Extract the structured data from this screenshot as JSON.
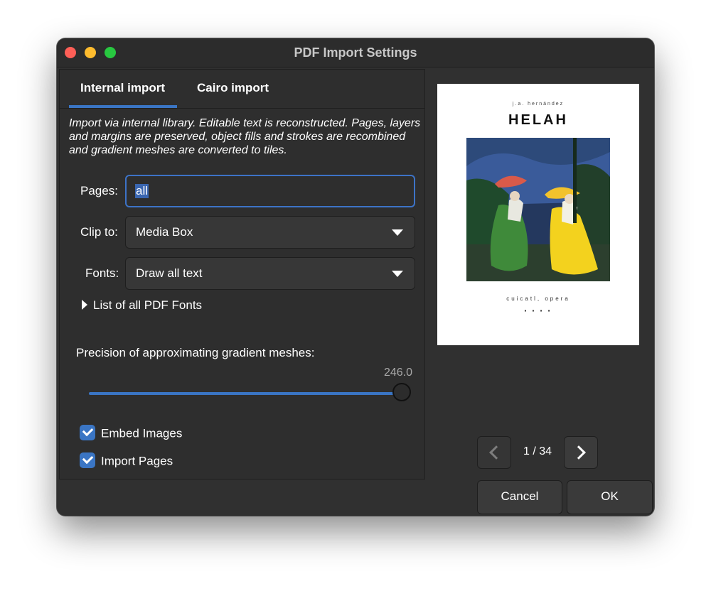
{
  "window": {
    "title": "PDF Import Settings"
  },
  "tabs": [
    {
      "label": "Internal import",
      "active": true
    },
    {
      "label": "Cairo import",
      "active": false
    }
  ],
  "description": "Import via internal library. Editable text is reconstructed. Pages, layers and margins are preserved, object fills and strokes are recombined and gradient meshes are converted to tiles.",
  "pages": {
    "label": "Pages:",
    "value": "all"
  },
  "clip": {
    "label": "Clip to:",
    "value": "Media Box"
  },
  "fonts": {
    "label": "Fonts:",
    "value": "Draw all text"
  },
  "font_list": {
    "label": "List of all PDF Fonts"
  },
  "precision": {
    "label": "Precision of approximating gradient meshes:",
    "value": "246.0",
    "fraction": 1.0
  },
  "checkboxes": {
    "embed_images": {
      "label": "Embed Images",
      "checked": true
    },
    "import_pages": {
      "label": "Import Pages",
      "checked": true
    }
  },
  "preview": {
    "author": "j.a. hernández",
    "title": "HELAH",
    "subtitle": "cuicatl, opera"
  },
  "pagination": {
    "indicator": "1 / 34"
  },
  "buttons": {
    "cancel": "Cancel",
    "ok": "OK"
  },
  "colors": {
    "accent": "#3a75c4",
    "window_bg": "#303030",
    "text": "#ffffff"
  }
}
